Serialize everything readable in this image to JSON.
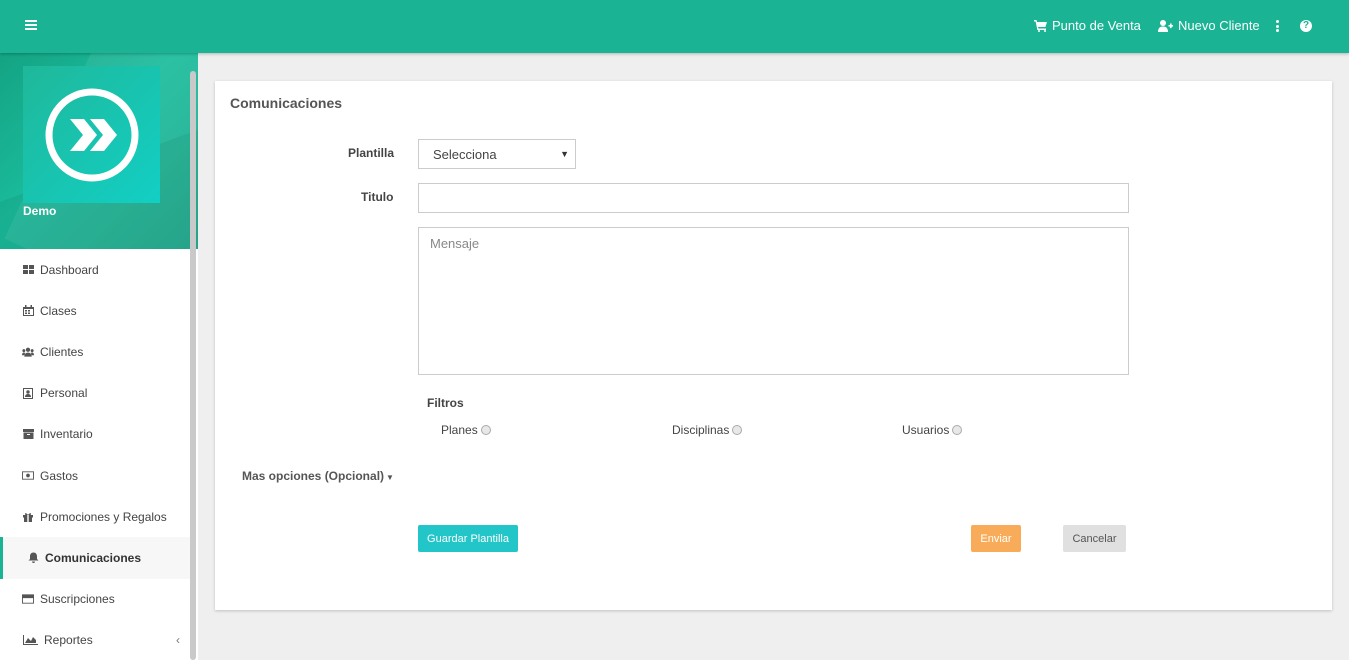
{
  "topbar": {
    "pos_label": "Punto de Venta",
    "new_client_label": "Nuevo Cliente",
    "help_glyph": "?"
  },
  "sidebar": {
    "user_name": "Demo",
    "items": [
      {
        "label": "Dashboard",
        "icon": "dashboard-icon"
      },
      {
        "label": "Clases",
        "icon": "calendar-icon"
      },
      {
        "label": "Clientes",
        "icon": "users-icon"
      },
      {
        "label": "Personal",
        "icon": "address-book-icon"
      },
      {
        "label": "Inventario",
        "icon": "archive-icon"
      },
      {
        "label": "Gastos",
        "icon": "money-icon"
      },
      {
        "label": "Promociones y Regalos",
        "icon": "gift-icon"
      },
      {
        "label": "Comunicaciones",
        "icon": "bell-icon",
        "active": true
      },
      {
        "label": "Suscripciones",
        "icon": "credit-card-icon"
      },
      {
        "label": "Reportes",
        "icon": "area-chart-icon",
        "arrow": "‹"
      }
    ]
  },
  "form": {
    "title": "Comunicaciones",
    "plantilla_label": "Plantilla",
    "plantilla_value": "Selecciona",
    "titulo_label": "Titulo",
    "titulo_value": "",
    "mensaje_placeholder": "Mensaje",
    "filtros_label": "Filtros",
    "filters": [
      "Planes",
      "Disciplinas",
      "Usuarios"
    ],
    "more_options_label": "Mas opciones (Opcional)",
    "save_template_label": "Guardar Plantilla",
    "send_label": "Enviar",
    "cancel_label": "Cancelar"
  },
  "colors": {
    "primary": "#1ab394",
    "info": "#23c6c8",
    "warning": "#f8ac59",
    "neutral": "#e0e0e0"
  }
}
